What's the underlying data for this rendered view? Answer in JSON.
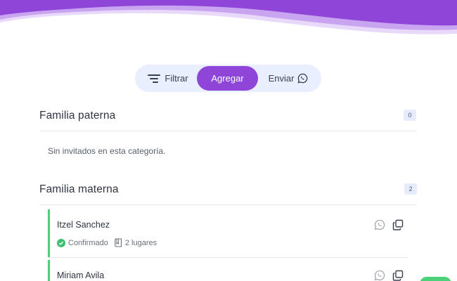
{
  "toolbar": {
    "filter_label": "Filtrar",
    "add_label": "Agregar",
    "send_label": "Enviar"
  },
  "colors": {
    "accent": "#8e45d8",
    "wave_light": "#c9a4f0",
    "confirmed": "#4cd07a",
    "pill_bg": "#e9efff"
  },
  "sections": [
    {
      "title": "Familia paterna",
      "count": "0",
      "empty_message": "Sin invitados en esta categoría."
    },
    {
      "title": "Familia materna",
      "count": "2",
      "guests": [
        {
          "name": "Itzel Sanchez",
          "status": "Confirmado",
          "seats": "2 lugares"
        },
        {
          "name": "Miriam Avila"
        }
      ]
    }
  ],
  "icons": {
    "filter": "filter-lines-icon",
    "send": "whatsapp-icon",
    "status": "check-circle-icon",
    "seats": "book-icon",
    "copy": "copy-icon"
  }
}
